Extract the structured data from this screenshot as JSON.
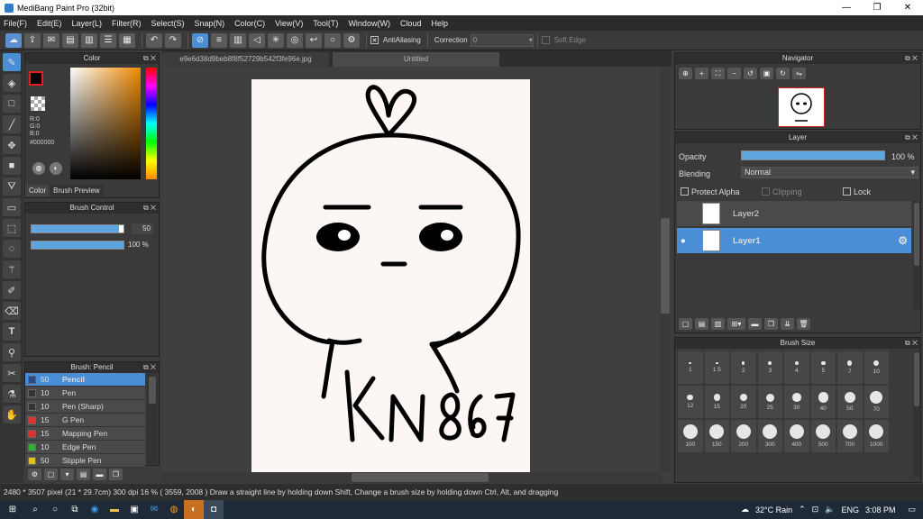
{
  "app": {
    "title": "MediBang Paint Pro (32bit)"
  },
  "menu": [
    "File(F)",
    "Edit(E)",
    "Layer(L)",
    "Filter(R)",
    "Select(S)",
    "Snap(N)",
    "Color(C)",
    "View(V)",
    "Tool(T)",
    "Window(W)",
    "Cloud",
    "Help"
  ],
  "toolbar": {
    "antialiasing": "AntiAliasing",
    "correction_label": "Correction",
    "correction_value": "0",
    "soft_edge": "Soft Edge"
  },
  "color_panel": {
    "title": "Color",
    "r": "R:0",
    "g": "G:0",
    "b": "B:0",
    "hex": "#000000",
    "tab_color": "Color",
    "tab_preview": "Brush Preview"
  },
  "brush_control": {
    "title": "Brush Control",
    "size_value": "50",
    "opacity_value": "100 %",
    "size_fill": 0.95,
    "opacity_fill": 1.0
  },
  "brush_list": {
    "title": "Brush: Pencil",
    "items": [
      {
        "size": "50",
        "name": "Pencil",
        "color": "#2a4a8a"
      },
      {
        "size": "10",
        "name": "Pen",
        "color": "#333333"
      },
      {
        "size": "10",
        "name": "Pen (Sharp)",
        "color": "#333333"
      },
      {
        "size": "15",
        "name": "G Pen",
        "color": "#e03030"
      },
      {
        "size": "15",
        "name": "Mapping Pen",
        "color": "#e03030"
      },
      {
        "size": "10",
        "name": "Edge Pen",
        "color": "#30b030"
      },
      {
        "size": "50",
        "name": "Stipple Pen",
        "color": "#e0c020"
      }
    ]
  },
  "tabs": {
    "file": "e9e6d38d9beb8f8f52729b542f3fe96e.jpg",
    "untitled": "Untitled"
  },
  "navigator": {
    "title": "Navigator"
  },
  "layer_panel": {
    "title": "Layer",
    "opacity_label": "Opacity",
    "opacity_value": "100 %",
    "blending_label": "Blending",
    "blending_value": "Normal",
    "protect_alpha": "Protect Alpha",
    "clipping": "Clipping",
    "lock": "Lock",
    "layers": [
      {
        "name": "Layer2"
      },
      {
        "name": "Layer1"
      }
    ]
  },
  "brush_size": {
    "title": "Brush Size",
    "sizes": [
      "1",
      "1.5",
      "2",
      "3",
      "4",
      "5",
      "7",
      "10",
      "12",
      "15",
      "20",
      "25",
      "30",
      "40",
      "50",
      "70",
      "100",
      "150",
      "200",
      "300",
      "400",
      "500",
      "700",
      "1000"
    ]
  },
  "status": "2480 * 3507 pixel   (21 * 29.7cm)   300 dpi   16 %   ( 3559, 2008 )   Draw a straight line by holding down Shift, Change a brush size by holding down Ctrl, Alt, and dragging",
  "taskbar": {
    "weather": "32°C  Rain",
    "lang": "ENG",
    "time": "3:08 PM"
  }
}
